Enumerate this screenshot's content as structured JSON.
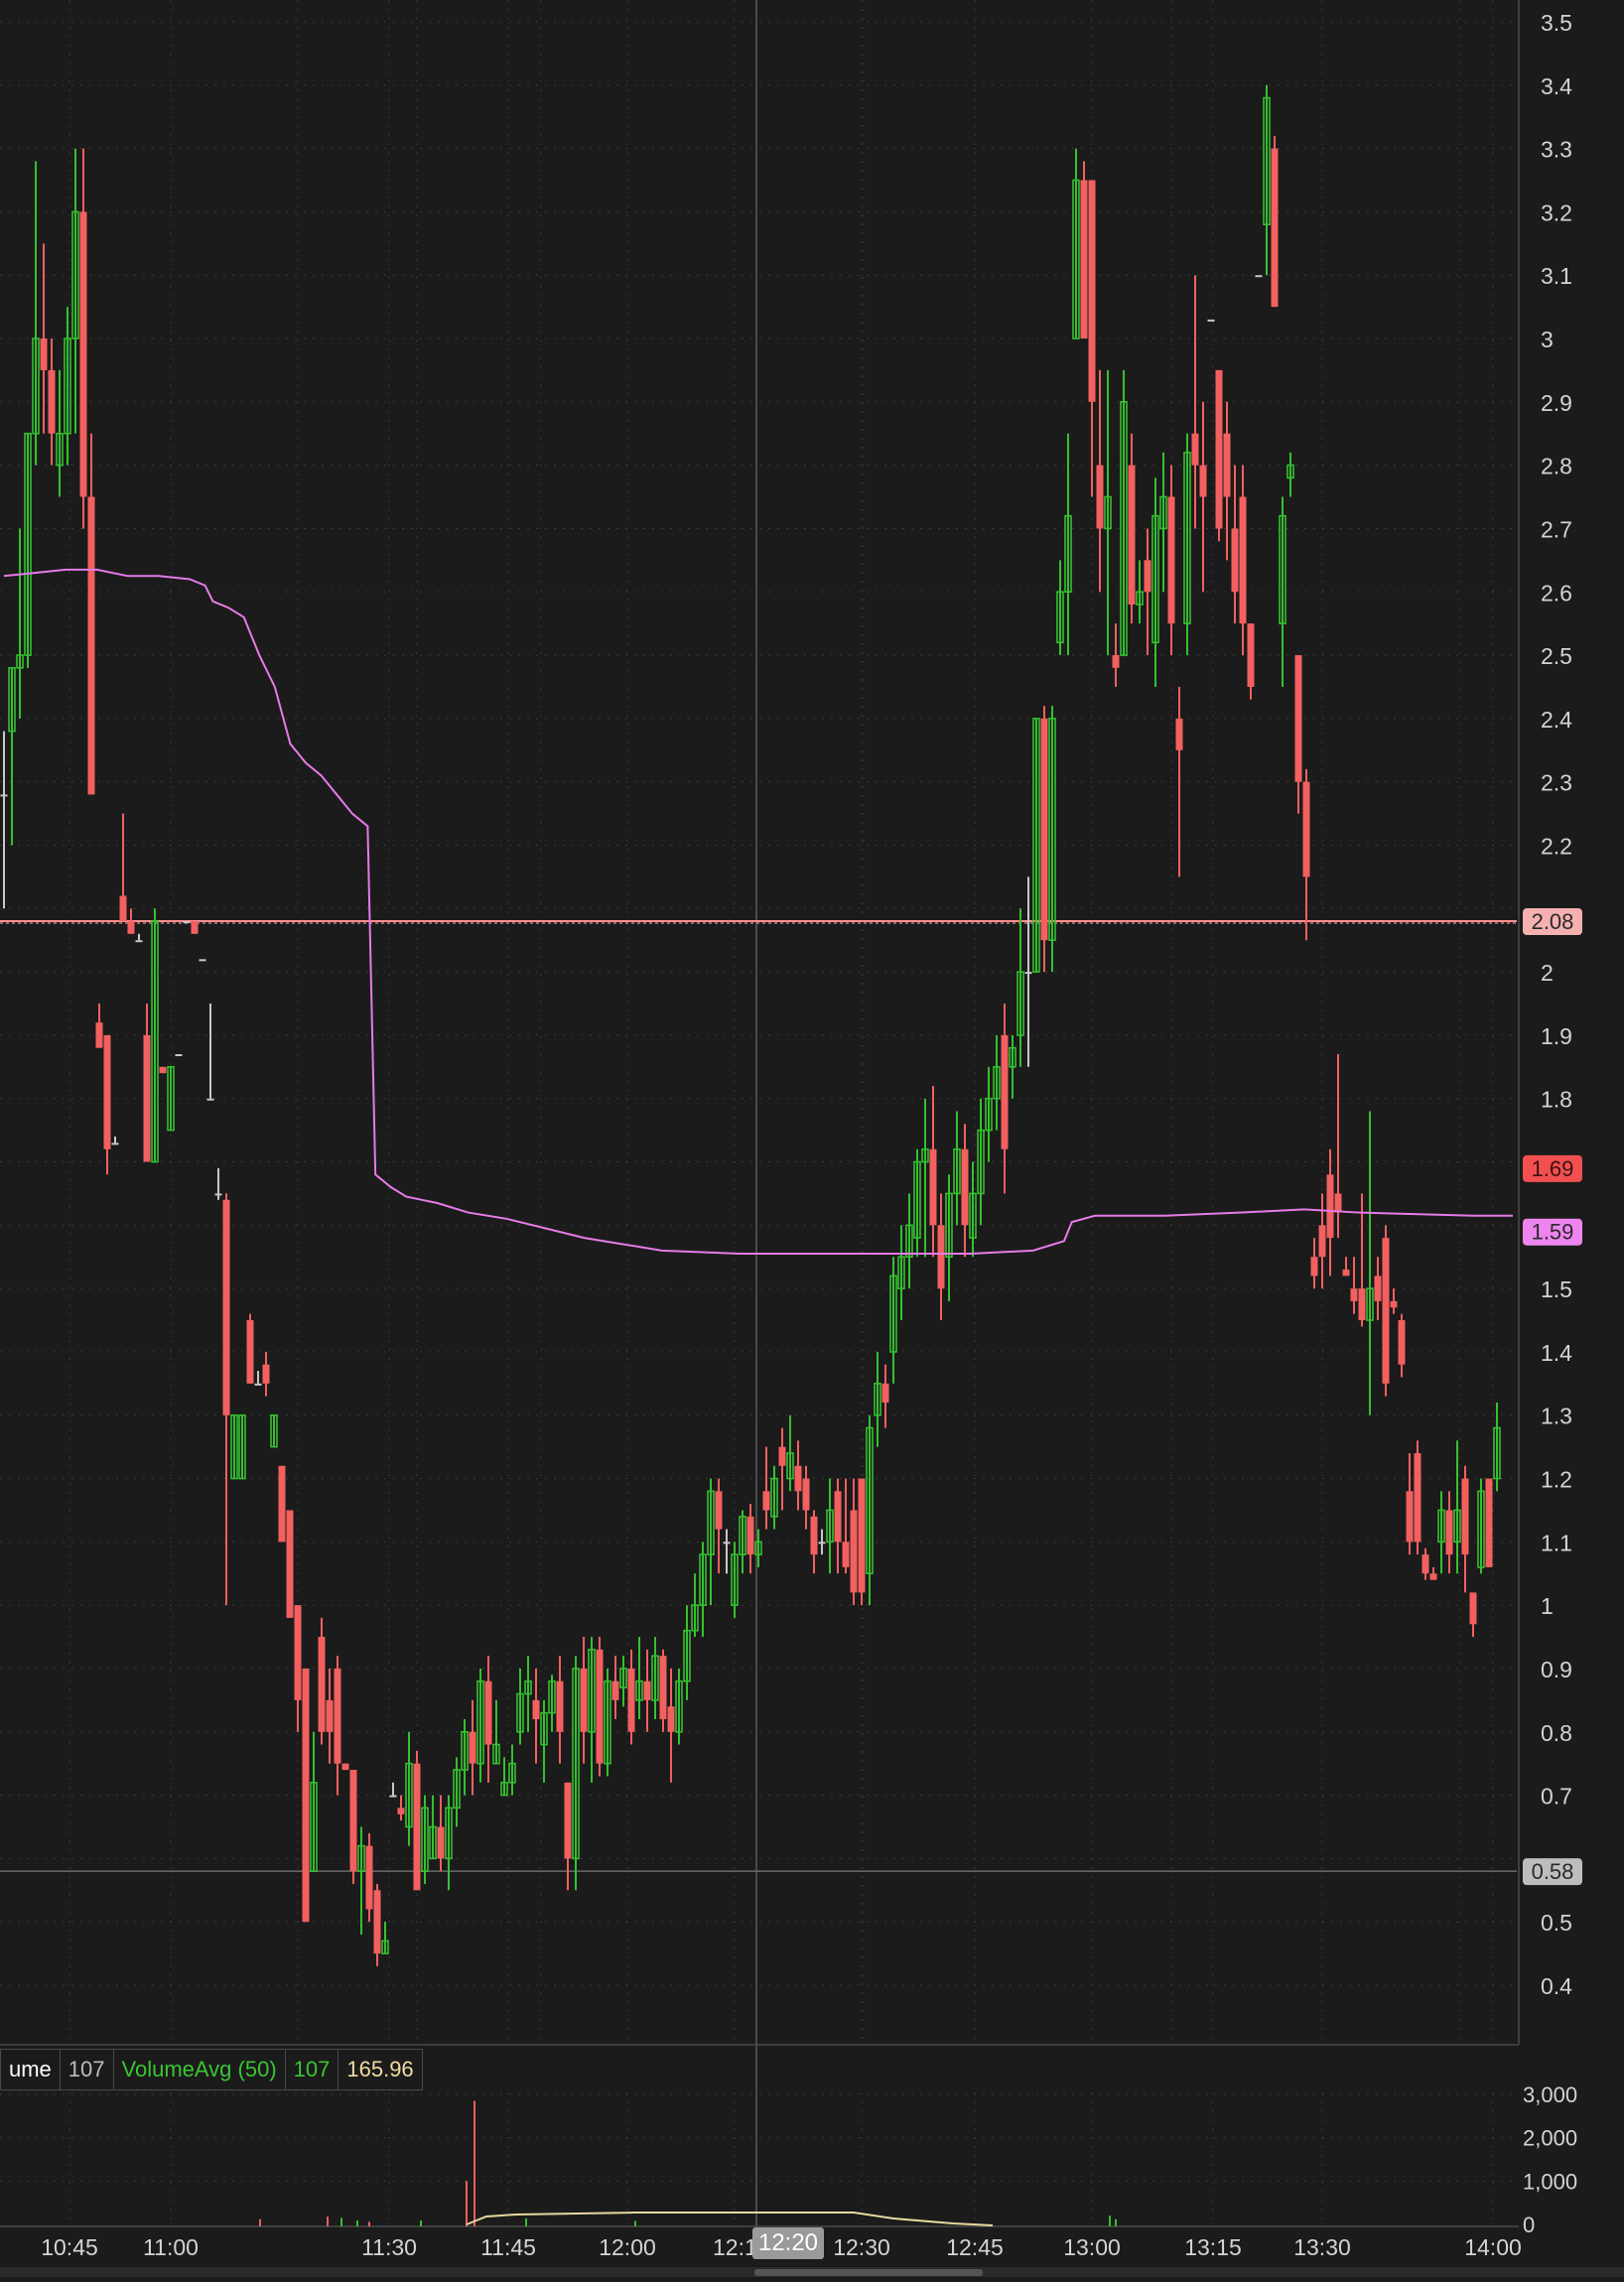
{
  "colors": {
    "background": "#1b1b1b",
    "grid": "#3a3a3a",
    "up": "#35c030",
    "down": "#f26060",
    "neutral": "#c8c8c8",
    "vwap": "#e57be8",
    "hline_pink": "#ff8e8e",
    "axis_text": "#d4d4d4"
  },
  "price_axis": {
    "ticks": [
      "3.5",
      "3.4",
      "3.3",
      "3.2",
      "3.1",
      "3",
      "2.9",
      "2.8",
      "2.7",
      "2.6",
      "2.5",
      "2.4",
      "2.3",
      "2.2",
      "2",
      "1.9",
      "1.8",
      "1.5",
      "1.4",
      "1.3",
      "1.2",
      "1.1",
      "1",
      "0.9",
      "0.8",
      "0.7",
      "0.5",
      "0.4"
    ],
    "markers": [
      {
        "label": "2.08",
        "value": 2.08,
        "style": "salmon"
      },
      {
        "label": "1.69",
        "value": 1.69,
        "style": "red"
      },
      {
        "label": "1.59",
        "value": 1.59,
        "style": "magenta"
      },
      {
        "label": "0.58",
        "value": 0.58,
        "style": "gray"
      }
    ]
  },
  "time_axis": {
    "labels": [
      "10:45",
      "11:00",
      "11:30",
      "11:45",
      "12:00",
      "12:1",
      "12:30",
      "12:45",
      "13:00",
      "13:15",
      "13:30",
      "14:00"
    ],
    "cursor_label": "12:20"
  },
  "study_bar": {
    "volume_name": "ume",
    "volume_value": "107",
    "avg_name": "VolumeAvg (50)",
    "avg_value": "107",
    "extra_value": "165.96"
  },
  "volume_axis": {
    "ticks": [
      "3,000",
      "2,000",
      "1,000",
      "0"
    ]
  },
  "chart_data": {
    "type": "candlestick",
    "title": "",
    "ylim": [
      0.32,
      3.52
    ],
    "x_range_minutes": [
      0,
      290
    ],
    "time_tick_minutes": {
      "10:45": 0,
      "11:00": 15,
      "11:30": 45,
      "11:45": 60,
      "12:00": 75,
      "12:1": 90,
      "12:30": 105,
      "12:45": 120,
      "13:00": 135,
      "13:15": 150,
      "13:30": 165,
      "14:00": 195
    },
    "note_scale": "candles follow minute bars on the displayed intraday axis",
    "candles": [
      [
        0,
        2.28,
        2.38,
        2.28,
        2.1
      ],
      [
        1,
        2.38,
        2.48,
        2.48,
        2.2
      ],
      [
        2,
        2.48,
        2.7,
        2.5,
        2.4
      ],
      [
        3,
        2.5,
        2.85,
        2.85,
        2.48
      ],
      [
        4,
        2.85,
        3.28,
        3.0,
        2.8
      ],
      [
        5,
        3.0,
        3.15,
        2.95,
        2.85
      ],
      [
        6,
        2.95,
        3.0,
        2.85,
        2.8
      ],
      [
        7,
        2.8,
        2.95,
        2.85,
        2.75
      ],
      [
        8,
        2.85,
        3.05,
        3.0,
        2.8
      ],
      [
        9,
        3.0,
        3.3,
        3.2,
        2.85
      ],
      [
        10,
        3.2,
        3.3,
        2.75,
        2.7
      ],
      [
        11,
        2.75,
        2.85,
        2.28,
        2.28
      ],
      [
        12,
        1.92,
        1.95,
        1.88,
        1.88
      ],
      [
        13,
        1.9,
        1.9,
        1.72,
        1.68
      ],
      [
        14,
        1.73,
        1.74,
        1.73,
        1.73
      ],
      [
        15,
        2.12,
        2.25,
        2.08,
        2.08
      ],
      [
        16,
        2.08,
        2.1,
        2.06,
        2.06
      ],
      [
        17,
        2.05,
        2.06,
        2.05,
        2.05
      ],
      [
        18,
        1.9,
        1.95,
        1.7,
        1.7
      ],
      [
        19,
        1.7,
        2.1,
        2.08,
        1.7
      ],
      [
        20,
        1.85,
        1.85,
        1.84,
        1.84
      ],
      [
        21,
        1.75,
        1.85,
        1.85,
        1.75
      ],
      [
        22,
        1.87,
        1.87,
        1.87,
        1.87
      ],
      [
        23,
        2.08,
        2.08,
        2.08,
        2.08
      ],
      [
        24,
        2.08,
        2.08,
        2.06,
        2.06
      ],
      [
        25,
        2.02,
        2.02,
        2.02,
        2.02
      ],
      [
        26,
        1.8,
        1.95,
        1.8,
        1.8
      ],
      [
        27,
        1.65,
        1.69,
        1.65,
        1.64
      ],
      [
        28,
        1.64,
        1.65,
        1.3,
        1.0
      ],
      [
        29,
        1.2,
        1.3,
        1.3,
        1.2
      ],
      [
        30,
        1.2,
        1.3,
        1.3,
        1.2
      ],
      [
        31,
        1.45,
        1.46,
        1.35,
        1.35
      ],
      [
        32,
        1.35,
        1.37,
        1.35,
        1.35
      ],
      [
        33,
        1.38,
        1.4,
        1.35,
        1.33
      ],
      [
        34,
        1.25,
        1.3,
        1.3,
        1.25
      ],
      [
        35,
        1.22,
        1.22,
        1.1,
        1.1
      ],
      [
        36,
        1.15,
        1.15,
        0.98,
        0.98
      ],
      [
        37,
        1.0,
        1.0,
        0.85,
        0.8
      ],
      [
        38,
        0.9,
        0.9,
        0.5,
        0.5
      ],
      [
        39,
        0.58,
        0.8,
        0.72,
        0.58
      ],
      [
        40,
        0.95,
        0.98,
        0.8,
        0.78
      ],
      [
        41,
        0.85,
        0.9,
        0.8,
        0.75
      ],
      [
        42,
        0.9,
        0.92,
        0.75,
        0.7
      ],
      [
        43,
        0.75,
        0.75,
        0.74,
        0.74
      ],
      [
        44,
        0.74,
        0.74,
        0.58,
        0.56
      ],
      [
        45,
        0.58,
        0.65,
        0.62,
        0.48
      ],
      [
        46,
        0.62,
        0.64,
        0.52,
        0.5
      ],
      [
        47,
        0.55,
        0.56,
        0.45,
        0.43
      ],
      [
        48,
        0.45,
        0.5,
        0.47,
        0.45
      ],
      [
        49,
        0.7,
        0.72,
        0.7,
        0.7
      ],
      [
        50,
        0.68,
        0.7,
        0.67,
        0.66
      ],
      [
        51,
        0.65,
        0.8,
        0.75,
        0.62
      ],
      [
        52,
        0.75,
        0.77,
        0.55,
        0.55
      ],
      [
        53,
        0.58,
        0.7,
        0.68,
        0.56
      ],
      [
        54,
        0.6,
        0.7,
        0.65,
        0.6
      ],
      [
        55,
        0.65,
        0.7,
        0.6,
        0.58
      ],
      [
        56,
        0.6,
        0.7,
        0.68,
        0.55
      ],
      [
        57,
        0.68,
        0.76,
        0.74,
        0.65
      ],
      [
        58,
        0.74,
        0.82,
        0.8,
        0.7
      ],
      [
        59,
        0.8,
        0.85,
        0.75,
        0.7
      ],
      [
        60,
        0.75,
        0.9,
        0.88,
        0.72
      ],
      [
        61,
        0.88,
        0.92,
        0.78,
        0.72
      ],
      [
        62,
        0.75,
        0.85,
        0.78,
        0.75
      ],
      [
        63,
        0.7,
        0.76,
        0.72,
        0.7
      ],
      [
        64,
        0.72,
        0.78,
        0.75,
        0.7
      ],
      [
        65,
        0.8,
        0.9,
        0.86,
        0.78
      ],
      [
        66,
        0.86,
        0.92,
        0.88,
        0.8
      ],
      [
        67,
        0.85,
        0.9,
        0.82,
        0.75
      ],
      [
        68,
        0.78,
        0.85,
        0.83,
        0.72
      ],
      [
        69,
        0.83,
        0.89,
        0.88,
        0.8
      ],
      [
        70,
        0.88,
        0.92,
        0.8,
        0.75
      ],
      [
        71,
        0.72,
        0.72,
        0.6,
        0.55
      ],
      [
        72,
        0.6,
        0.92,
        0.9,
        0.55
      ],
      [
        73,
        0.9,
        0.95,
        0.8,
        0.75
      ],
      [
        74,
        0.8,
        0.95,
        0.93,
        0.72
      ],
      [
        75,
        0.93,
        0.95,
        0.75,
        0.73
      ],
      [
        76,
        0.75,
        0.9,
        0.88,
        0.73
      ],
      [
        77,
        0.88,
        0.92,
        0.85,
        0.82
      ],
      [
        78,
        0.87,
        0.92,
        0.9,
        0.84
      ],
      [
        79,
        0.9,
        0.93,
        0.8,
        0.78
      ],
      [
        80,
        0.85,
        0.95,
        0.88,
        0.82
      ],
      [
        81,
        0.88,
        0.93,
        0.85,
        0.8
      ],
      [
        82,
        0.85,
        0.95,
        0.92,
        0.82
      ],
      [
        83,
        0.92,
        0.93,
        0.82,
        0.8
      ],
      [
        84,
        0.84,
        0.9,
        0.8,
        0.72
      ],
      [
        85,
        0.8,
        0.9,
        0.88,
        0.78
      ],
      [
        86,
        0.88,
        1.0,
        0.96,
        0.85
      ],
      [
        87,
        0.96,
        1.05,
        1.0,
        0.95
      ],
      [
        88,
        1.0,
        1.1,
        1.08,
        0.95
      ],
      [
        89,
        1.08,
        1.2,
        1.18,
        1.0
      ],
      [
        90,
        1.18,
        1.2,
        1.12,
        1.05
      ],
      [
        91,
        1.1,
        1.12,
        1.1,
        1.05
      ],
      [
        92,
        1.0,
        1.1,
        1.08,
        0.98
      ],
      [
        93,
        1.08,
        1.15,
        1.14,
        1.05
      ],
      [
        94,
        1.14,
        1.16,
        1.08,
        1.05
      ],
      [
        95,
        1.08,
        1.12,
        1.1,
        1.06
      ],
      [
        96,
        1.18,
        1.25,
        1.15,
        1.12
      ],
      [
        97,
        1.14,
        1.22,
        1.2,
        1.12
      ],
      [
        98,
        1.25,
        1.28,
        1.22,
        1.15
      ],
      [
        99,
        1.2,
        1.3,
        1.24,
        1.18
      ],
      [
        100,
        1.22,
        1.26,
        1.18,
        1.15
      ],
      [
        101,
        1.2,
        1.22,
        1.15,
        1.12
      ],
      [
        102,
        1.14,
        1.15,
        1.08,
        1.05
      ],
      [
        103,
        1.1,
        1.12,
        1.1,
        1.08
      ],
      [
        104,
        1.1,
        1.2,
        1.15,
        1.05
      ],
      [
        105,
        1.18,
        1.2,
        1.1,
        1.05
      ],
      [
        106,
        1.1,
        1.2,
        1.06,
        1.05
      ],
      [
        107,
        1.15,
        1.2,
        1.02,
        1.0
      ],
      [
        108,
        1.2,
        1.2,
        1.02,
        1.0
      ],
      [
        109,
        1.05,
        1.3,
        1.28,
        1.0
      ],
      [
        110,
        1.3,
        1.4,
        1.35,
        1.25
      ],
      [
        111,
        1.35,
        1.38,
        1.32,
        1.28
      ],
      [
        112,
        1.4,
        1.55,
        1.52,
        1.35
      ],
      [
        113,
        1.5,
        1.6,
        1.55,
        1.45
      ],
      [
        114,
        1.55,
        1.65,
        1.6,
        1.5
      ],
      [
        115,
        1.58,
        1.72,
        1.7,
        1.55
      ],
      [
        116,
        1.7,
        1.8,
        1.72,
        1.55
      ],
      [
        117,
        1.72,
        1.82,
        1.6,
        1.55
      ],
      [
        118,
        1.6,
        1.65,
        1.5,
        1.45
      ],
      [
        119,
        1.55,
        1.68,
        1.65,
        1.48
      ],
      [
        120,
        1.65,
        1.78,
        1.72,
        1.6
      ],
      [
        121,
        1.72,
        1.76,
        1.6,
        1.55
      ],
      [
        122,
        1.58,
        1.7,
        1.65,
        1.55
      ],
      [
        123,
        1.65,
        1.8,
        1.75,
        1.6
      ],
      [
        124,
        1.75,
        1.85,
        1.8,
        1.7
      ],
      [
        125,
        1.8,
        1.9,
        1.85,
        1.75
      ],
      [
        126,
        1.9,
        1.95,
        1.72,
        1.65
      ],
      [
        127,
        1.85,
        1.9,
        1.88,
        1.8
      ],
      [
        128,
        1.9,
        2.1,
        2.0,
        1.85
      ],
      [
        129,
        2.0,
        2.15,
        2.0,
        1.85
      ],
      [
        130,
        2.0,
        2.4,
        2.4,
        2.0
      ],
      [
        131,
        2.4,
        2.42,
        2.05,
        2.0
      ],
      [
        132,
        2.05,
        2.42,
        2.4,
        2.0
      ],
      [
        133,
        2.52,
        2.65,
        2.6,
        2.5
      ],
      [
        134,
        2.6,
        2.85,
        2.72,
        2.5
      ],
      [
        135,
        3.0,
        3.3,
        3.25,
        3.0
      ],
      [
        136,
        3.25,
        3.28,
        3.0,
        3.0
      ],
      [
        137,
        3.25,
        3.25,
        2.9,
        2.75
      ],
      [
        138,
        2.8,
        2.95,
        2.7,
        2.6
      ],
      [
        139,
        2.7,
        2.95,
        2.75,
        2.5
      ],
      [
        140,
        2.5,
        2.55,
        2.48,
        2.45
      ],
      [
        141,
        2.5,
        2.95,
        2.9,
        2.5
      ],
      [
        142,
        2.8,
        2.85,
        2.58,
        2.55
      ],
      [
        143,
        2.58,
        2.65,
        2.6,
        2.55
      ],
      [
        144,
        2.65,
        2.7,
        2.6,
        2.5
      ],
      [
        145,
        2.52,
        2.78,
        2.72,
        2.45
      ],
      [
        146,
        2.7,
        2.82,
        2.75,
        2.6
      ],
      [
        147,
        2.75,
        2.8,
        2.55,
        2.5
      ],
      [
        148,
        2.4,
        2.45,
        2.35,
        2.15
      ],
      [
        149,
        2.55,
        2.85,
        2.82,
        2.5
      ],
      [
        150,
        2.85,
        3.1,
        2.8,
        2.7
      ],
      [
        151,
        2.8,
        2.9,
        2.75,
        2.6
      ],
      [
        152,
        3.03,
        3.03,
        3.03,
        3.03
      ],
      [
        153,
        2.95,
        2.95,
        2.7,
        2.68
      ],
      [
        154,
        2.85,
        2.9,
        2.75,
        2.65
      ],
      [
        155,
        2.7,
        2.8,
        2.6,
        2.55
      ],
      [
        156,
        2.75,
        2.8,
        2.55,
        2.5
      ],
      [
        157,
        2.55,
        2.55,
        2.45,
        2.43
      ],
      [
        158,
        3.1,
        3.1,
        3.1,
        3.1
      ],
      [
        159,
        3.18,
        3.4,
        3.38,
        3.1
      ],
      [
        160,
        3.3,
        3.32,
        3.05,
        3.05
      ],
      [
        161,
        2.55,
        2.75,
        2.72,
        2.45
      ],
      [
        162,
        2.78,
        2.82,
        2.8,
        2.75
      ],
      [
        163,
        2.5,
        2.5,
        2.3,
        2.25
      ],
      [
        164,
        2.3,
        2.32,
        2.15,
        2.05
      ],
      [
        165,
        1.55,
        1.58,
        1.52,
        1.5
      ],
      [
        166,
        1.6,
        1.65,
        1.55,
        1.5
      ],
      [
        167,
        1.68,
        1.72,
        1.58,
        1.52
      ],
      [
        168,
        1.65,
        1.87,
        1.62,
        1.58
      ],
      [
        169,
        1.53,
        1.55,
        1.52,
        1.52
      ],
      [
        170,
        1.5,
        1.55,
        1.48,
        1.46
      ],
      [
        171,
        1.5,
        1.65,
        1.45,
        1.44
      ],
      [
        172,
        1.45,
        1.78,
        1.5,
        1.3
      ],
      [
        173,
        1.52,
        1.55,
        1.48,
        1.45
      ],
      [
        174,
        1.58,
        1.6,
        1.35,
        1.33
      ],
      [
        175,
        1.48,
        1.5,
        1.47,
        1.46
      ],
      [
        176,
        1.45,
        1.46,
        1.38,
        1.36
      ],
      [
        177,
        1.18,
        1.24,
        1.1,
        1.08
      ],
      [
        178,
        1.24,
        1.26,
        1.1,
        1.08
      ],
      [
        179,
        1.08,
        1.09,
        1.05,
        1.04
      ],
      [
        180,
        1.05,
        1.06,
        1.04,
        1.04
      ],
      [
        181,
        1.1,
        1.18,
        1.15,
        1.05
      ],
      [
        182,
        1.15,
        1.18,
        1.08,
        1.05
      ],
      [
        183,
        1.1,
        1.26,
        1.15,
        1.05
      ],
      [
        184,
        1.2,
        1.22,
        1.08,
        1.02
      ],
      [
        185,
        1.02,
        1.02,
        0.97,
        0.95
      ],
      [
        186,
        1.06,
        1.2,
        1.18,
        1.05
      ],
      [
        187,
        1.2,
        1.2,
        1.06,
        1.06
      ],
      [
        188,
        1.2,
        1.32,
        1.28,
        1.18
      ]
    ],
    "vwap_points": [
      [
        0,
        2.625
      ],
      [
        4,
        2.63
      ],
      [
        8,
        2.635
      ],
      [
        12,
        2.635
      ],
      [
        16,
        2.625
      ],
      [
        20,
        2.625
      ],
      [
        24,
        2.62
      ],
      [
        26,
        2.61
      ],
      [
        27,
        2.585
      ],
      [
        29,
        2.575
      ],
      [
        31,
        2.56
      ],
      [
        33,
        2.5
      ],
      [
        35,
        2.45
      ],
      [
        37,
        2.36
      ],
      [
        39,
        2.33
      ],
      [
        41,
        2.31
      ],
      [
        43,
        2.28
      ],
      [
        45,
        2.25
      ],
      [
        47,
        2.23
      ],
      [
        48,
        1.68
      ],
      [
        50,
        1.66
      ],
      [
        52,
        1.645
      ],
      [
        54,
        1.64
      ],
      [
        56,
        1.635
      ],
      [
        60,
        1.62
      ],
      [
        65,
        1.61
      ],
      [
        70,
        1.595
      ],
      [
        75,
        1.58
      ],
      [
        80,
        1.57
      ],
      [
        85,
        1.56
      ],
      [
        95,
        1.555
      ],
      [
        110,
        1.555
      ],
      [
        125,
        1.555
      ],
      [
        133,
        1.56
      ],
      [
        137,
        1.575
      ],
      [
        138,
        1.605
      ],
      [
        141,
        1.615
      ],
      [
        150,
        1.615
      ],
      [
        160,
        1.62
      ],
      [
        168,
        1.625
      ],
      [
        175,
        1.62
      ],
      [
        190,
        1.615
      ],
      [
        195,
        1.615
      ]
    ],
    "vwap_name": "",
    "hlines": [
      {
        "value": 2.08,
        "color": "pink"
      },
      {
        "value": 0.58,
        "color": "gray"
      }
    ],
    "volume_ylim": [
      0,
      3000
    ],
    "volume_spike": {
      "minute": 47,
      "value": 2850
    }
  }
}
